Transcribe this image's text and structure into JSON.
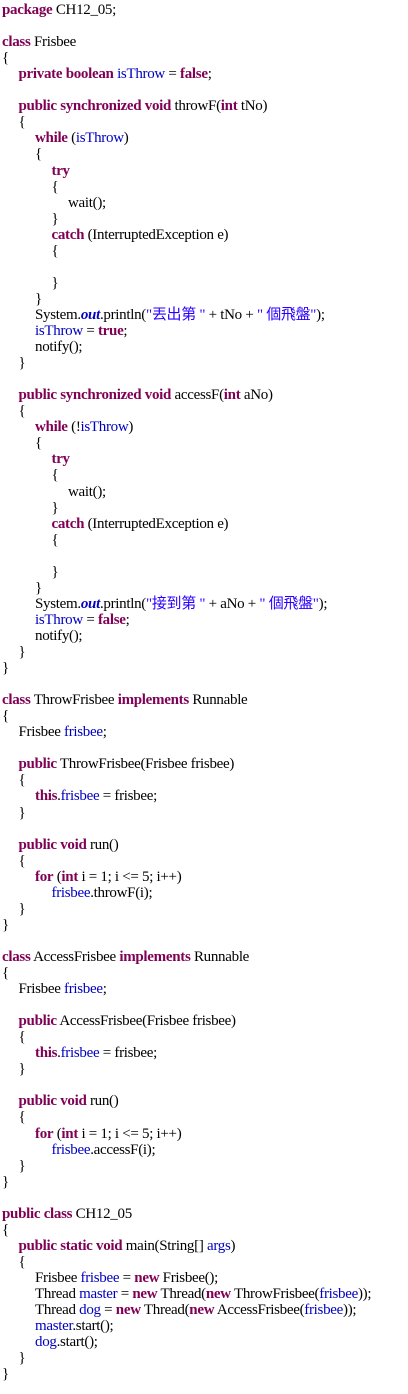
{
  "editor": {
    "language": "java",
    "colors": {
      "keyword": "#7f0055",
      "field": "#0000c0",
      "string": "#2a00ff",
      "plain": "#000000",
      "background": "#ffffff"
    },
    "lines": [
      {
        "indent": 0,
        "tokens": [
          {
            "t": "package",
            "c": "kw"
          },
          {
            "t": " CH12_05;"
          }
        ]
      },
      {
        "indent": 0,
        "tokens": []
      },
      {
        "indent": 0,
        "tokens": [
          {
            "t": "class",
            "c": "kw"
          },
          {
            "t": " Frisbee"
          }
        ]
      },
      {
        "indent": 0,
        "tokens": [
          {
            "t": "{"
          }
        ]
      },
      {
        "indent": 1,
        "tokens": [
          {
            "t": "private",
            "c": "kw"
          },
          {
            "t": " "
          },
          {
            "t": "boolean",
            "c": "kw"
          },
          {
            "t": " "
          },
          {
            "t": "isThrow",
            "c": "fd"
          },
          {
            "t": " = "
          },
          {
            "t": "false",
            "c": "kw"
          },
          {
            "t": ";"
          }
        ]
      },
      {
        "indent": 0,
        "tokens": []
      },
      {
        "indent": 1,
        "tokens": [
          {
            "t": "public",
            "c": "kw"
          },
          {
            "t": " "
          },
          {
            "t": "synchronized",
            "c": "kw"
          },
          {
            "t": " "
          },
          {
            "t": "void",
            "c": "kw"
          },
          {
            "t": " throwF("
          },
          {
            "t": "int",
            "c": "kw"
          },
          {
            "t": " tNo)"
          }
        ]
      },
      {
        "indent": 1,
        "tokens": [
          {
            "t": "{"
          }
        ]
      },
      {
        "indent": 2,
        "tokens": [
          {
            "t": "while",
            "c": "kw"
          },
          {
            "t": " ("
          },
          {
            "t": "isThrow",
            "c": "fd"
          },
          {
            "t": ")"
          }
        ]
      },
      {
        "indent": 2,
        "tokens": [
          {
            "t": "{"
          }
        ]
      },
      {
        "indent": 3,
        "tokens": [
          {
            "t": "try",
            "c": "kw"
          }
        ]
      },
      {
        "indent": 3,
        "tokens": [
          {
            "t": "{"
          }
        ]
      },
      {
        "indent": 4,
        "tokens": [
          {
            "t": "wait();"
          }
        ]
      },
      {
        "indent": 3,
        "tokens": [
          {
            "t": "}"
          }
        ]
      },
      {
        "indent": 3,
        "tokens": [
          {
            "t": "catch",
            "c": "kw"
          },
          {
            "t": " (InterruptedException e)"
          }
        ]
      },
      {
        "indent": 3,
        "tokens": [
          {
            "t": "{"
          }
        ]
      },
      {
        "indent": 0,
        "tokens": []
      },
      {
        "indent": 3,
        "tokens": [
          {
            "t": "}"
          }
        ]
      },
      {
        "indent": 2,
        "tokens": [
          {
            "t": "}"
          }
        ]
      },
      {
        "indent": 2,
        "tokens": [
          {
            "t": "System."
          },
          {
            "t": "out",
            "c": "sf"
          },
          {
            "t": ".println("
          },
          {
            "t": "\"丟出第 \"",
            "c": "st"
          },
          {
            "t": " + tNo + "
          },
          {
            "t": "\" 個飛盤\"",
            "c": "st"
          },
          {
            "t": ");"
          }
        ]
      },
      {
        "indent": 2,
        "tokens": [
          {
            "t": "isThrow",
            "c": "fd"
          },
          {
            "t": " = "
          },
          {
            "t": "true",
            "c": "kw"
          },
          {
            "t": ";"
          }
        ]
      },
      {
        "indent": 2,
        "tokens": [
          {
            "t": "notify();"
          }
        ]
      },
      {
        "indent": 1,
        "tokens": [
          {
            "t": "}"
          }
        ]
      },
      {
        "indent": 0,
        "tokens": []
      },
      {
        "indent": 1,
        "tokens": [
          {
            "t": "public",
            "c": "kw"
          },
          {
            "t": " "
          },
          {
            "t": "synchronized",
            "c": "kw"
          },
          {
            "t": " "
          },
          {
            "t": "void",
            "c": "kw"
          },
          {
            "t": " accessF("
          },
          {
            "t": "int",
            "c": "kw"
          },
          {
            "t": " aNo)"
          }
        ]
      },
      {
        "indent": 1,
        "tokens": [
          {
            "t": "{"
          }
        ]
      },
      {
        "indent": 2,
        "tokens": [
          {
            "t": "while",
            "c": "kw"
          },
          {
            "t": " (!"
          },
          {
            "t": "isThrow",
            "c": "fd"
          },
          {
            "t": ")"
          }
        ]
      },
      {
        "indent": 2,
        "tokens": [
          {
            "t": "{"
          }
        ]
      },
      {
        "indent": 3,
        "tokens": [
          {
            "t": "try",
            "c": "kw"
          }
        ]
      },
      {
        "indent": 3,
        "tokens": [
          {
            "t": "{"
          }
        ]
      },
      {
        "indent": 4,
        "tokens": [
          {
            "t": "wait();"
          }
        ]
      },
      {
        "indent": 3,
        "tokens": [
          {
            "t": "}"
          }
        ]
      },
      {
        "indent": 3,
        "tokens": [
          {
            "t": "catch",
            "c": "kw"
          },
          {
            "t": " (InterruptedException e)"
          }
        ]
      },
      {
        "indent": 3,
        "tokens": [
          {
            "t": "{"
          }
        ]
      },
      {
        "indent": 0,
        "tokens": []
      },
      {
        "indent": 3,
        "tokens": [
          {
            "t": "}"
          }
        ]
      },
      {
        "indent": 2,
        "tokens": [
          {
            "t": "}"
          }
        ]
      },
      {
        "indent": 2,
        "tokens": [
          {
            "t": "System."
          },
          {
            "t": "out",
            "c": "sf"
          },
          {
            "t": ".println("
          },
          {
            "t": "\"接到第 \"",
            "c": "st"
          },
          {
            "t": " + aNo + "
          },
          {
            "t": "\" 個飛盤\"",
            "c": "st"
          },
          {
            "t": ");"
          }
        ]
      },
      {
        "indent": 2,
        "tokens": [
          {
            "t": "isThrow",
            "c": "fd"
          },
          {
            "t": " = "
          },
          {
            "t": "false",
            "c": "kw"
          },
          {
            "t": ";"
          }
        ]
      },
      {
        "indent": 2,
        "tokens": [
          {
            "t": "notify();"
          }
        ]
      },
      {
        "indent": 1,
        "tokens": [
          {
            "t": "}"
          }
        ]
      },
      {
        "indent": 0,
        "tokens": [
          {
            "t": "}"
          }
        ]
      },
      {
        "indent": 0,
        "tokens": []
      },
      {
        "indent": 0,
        "tokens": [
          {
            "t": "class",
            "c": "kw"
          },
          {
            "t": " ThrowFrisbee "
          },
          {
            "t": "implements",
            "c": "kw"
          },
          {
            "t": " Runnable"
          }
        ]
      },
      {
        "indent": 0,
        "tokens": [
          {
            "t": "{"
          }
        ]
      },
      {
        "indent": 1,
        "tokens": [
          {
            "t": "Frisbee "
          },
          {
            "t": "frisbee",
            "c": "fd"
          },
          {
            "t": ";"
          }
        ]
      },
      {
        "indent": 0,
        "tokens": []
      },
      {
        "indent": 1,
        "tokens": [
          {
            "t": "public",
            "c": "kw"
          },
          {
            "t": " ThrowFrisbee(Frisbee frisbee)"
          }
        ]
      },
      {
        "indent": 1,
        "tokens": [
          {
            "t": "{"
          }
        ]
      },
      {
        "indent": 2,
        "tokens": [
          {
            "t": "this",
            "c": "kw"
          },
          {
            "t": "."
          },
          {
            "t": "frisbee",
            "c": "fd"
          },
          {
            "t": " = frisbee;"
          }
        ]
      },
      {
        "indent": 1,
        "tokens": [
          {
            "t": "}"
          }
        ]
      },
      {
        "indent": 0,
        "tokens": []
      },
      {
        "indent": 1,
        "tokens": [
          {
            "t": "public",
            "c": "kw"
          },
          {
            "t": " "
          },
          {
            "t": "void",
            "c": "kw"
          },
          {
            "t": " run()"
          }
        ]
      },
      {
        "indent": 1,
        "tokens": [
          {
            "t": "{"
          }
        ]
      },
      {
        "indent": 2,
        "tokens": [
          {
            "t": "for",
            "c": "kw"
          },
          {
            "t": " ("
          },
          {
            "t": "int",
            "c": "kw"
          },
          {
            "t": " i = 1; i <= 5; i++)"
          }
        ]
      },
      {
        "indent": 3,
        "tokens": [
          {
            "t": "frisbee",
            "c": "fd"
          },
          {
            "t": ".throwF(i);"
          }
        ]
      },
      {
        "indent": 1,
        "tokens": [
          {
            "t": "}"
          }
        ]
      },
      {
        "indent": 0,
        "tokens": [
          {
            "t": "}"
          }
        ]
      },
      {
        "indent": 0,
        "tokens": []
      },
      {
        "indent": 0,
        "tokens": [
          {
            "t": "class",
            "c": "kw"
          },
          {
            "t": " AccessFrisbee "
          },
          {
            "t": "implements",
            "c": "kw"
          },
          {
            "t": " Runnable"
          }
        ]
      },
      {
        "indent": 0,
        "tokens": [
          {
            "t": "{"
          }
        ]
      },
      {
        "indent": 1,
        "tokens": [
          {
            "t": "Frisbee "
          },
          {
            "t": "frisbee",
            "c": "fd"
          },
          {
            "t": ";"
          }
        ]
      },
      {
        "indent": 0,
        "tokens": []
      },
      {
        "indent": 1,
        "tokens": [
          {
            "t": "public",
            "c": "kw"
          },
          {
            "t": " AccessFrisbee(Frisbee frisbee)"
          }
        ]
      },
      {
        "indent": 1,
        "tokens": [
          {
            "t": "{"
          }
        ]
      },
      {
        "indent": 2,
        "tokens": [
          {
            "t": "this",
            "c": "kw"
          },
          {
            "t": "."
          },
          {
            "t": "frisbee",
            "c": "fd"
          },
          {
            "t": " = frisbee;"
          }
        ]
      },
      {
        "indent": 1,
        "tokens": [
          {
            "t": "}"
          }
        ]
      },
      {
        "indent": 0,
        "tokens": []
      },
      {
        "indent": 1,
        "tokens": [
          {
            "t": "public",
            "c": "kw"
          },
          {
            "t": " "
          },
          {
            "t": "void",
            "c": "kw"
          },
          {
            "t": " run()"
          }
        ]
      },
      {
        "indent": 1,
        "tokens": [
          {
            "t": "{"
          }
        ]
      },
      {
        "indent": 2,
        "tokens": [
          {
            "t": "for",
            "c": "kw"
          },
          {
            "t": " ("
          },
          {
            "t": "int",
            "c": "kw"
          },
          {
            "t": " i = 1; i <= 5; i++)"
          }
        ]
      },
      {
        "indent": 3,
        "tokens": [
          {
            "t": "frisbee",
            "c": "fd"
          },
          {
            "t": ".accessF(i);"
          }
        ]
      },
      {
        "indent": 1,
        "tokens": [
          {
            "t": "}"
          }
        ]
      },
      {
        "indent": 0,
        "tokens": [
          {
            "t": "}"
          }
        ]
      },
      {
        "indent": 0,
        "tokens": []
      },
      {
        "indent": 0,
        "tokens": [
          {
            "t": "public",
            "c": "kw"
          },
          {
            "t": " "
          },
          {
            "t": "class",
            "c": "kw"
          },
          {
            "t": " CH12_05"
          }
        ]
      },
      {
        "indent": 0,
        "tokens": [
          {
            "t": "{"
          }
        ]
      },
      {
        "indent": 1,
        "tokens": [
          {
            "t": "public",
            "c": "kw"
          },
          {
            "t": " "
          },
          {
            "t": "static",
            "c": "kw"
          },
          {
            "t": " "
          },
          {
            "t": "void",
            "c": "kw"
          },
          {
            "t": " main(String[] "
          },
          {
            "t": "args",
            "c": "fd"
          },
          {
            "t": ")"
          }
        ]
      },
      {
        "indent": 1,
        "tokens": [
          {
            "t": "{"
          }
        ]
      },
      {
        "indent": 2,
        "tokens": [
          {
            "t": "Frisbee "
          },
          {
            "t": "frisbee",
            "c": "fd"
          },
          {
            "t": " = "
          },
          {
            "t": "new",
            "c": "kw"
          },
          {
            "t": " Frisbee();"
          }
        ]
      },
      {
        "indent": 2,
        "tokens": [
          {
            "t": "Thread "
          },
          {
            "t": "master",
            "c": "fd"
          },
          {
            "t": " = "
          },
          {
            "t": "new",
            "c": "kw"
          },
          {
            "t": " Thread("
          },
          {
            "t": "new",
            "c": "kw"
          },
          {
            "t": " ThrowFrisbee("
          },
          {
            "t": "frisbee",
            "c": "fd"
          },
          {
            "t": "));"
          }
        ]
      },
      {
        "indent": 2,
        "tokens": [
          {
            "t": "Thread "
          },
          {
            "t": "dog",
            "c": "fd"
          },
          {
            "t": " = "
          },
          {
            "t": "new",
            "c": "kw"
          },
          {
            "t": " Thread("
          },
          {
            "t": "new",
            "c": "kw"
          },
          {
            "t": " AccessFrisbee("
          },
          {
            "t": "frisbee",
            "c": "fd"
          },
          {
            "t": "));"
          }
        ]
      },
      {
        "indent": 2,
        "tokens": [
          {
            "t": "master",
            "c": "fd"
          },
          {
            "t": ".start();"
          }
        ]
      },
      {
        "indent": 2,
        "tokens": [
          {
            "t": "dog",
            "c": "fd"
          },
          {
            "t": ".start();"
          }
        ]
      },
      {
        "indent": 1,
        "tokens": [
          {
            "t": "}"
          }
        ]
      },
      {
        "indent": 0,
        "tokens": [
          {
            "t": "}"
          }
        ]
      }
    ]
  }
}
